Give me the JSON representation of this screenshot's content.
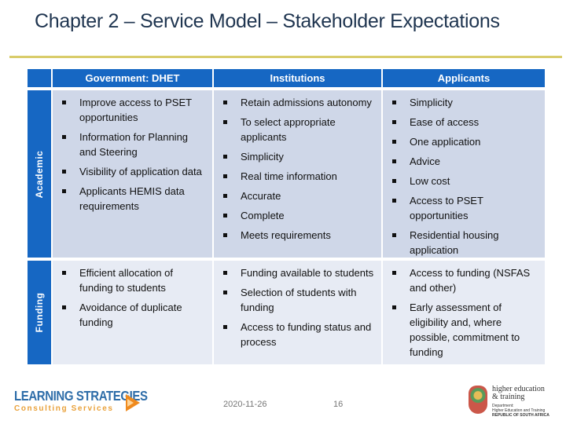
{
  "slide": {
    "title": "Chapter 2 – Service Model – Stakeholder Expectations",
    "accent_color": "#1667c3",
    "rule_color": "#d9cc6a"
  },
  "table": {
    "headers": [
      "",
      "Government: DHET",
      "Institutions",
      "Applicants"
    ],
    "rows": [
      {
        "label": "Academic",
        "government": [
          "Improve access to PSET opportunities",
          "Information for Planning and Steering",
          "Visibility of application data",
          "Applicants HEMIS data requirements"
        ],
        "institutions": [
          "Retain admissions autonomy",
          "To select appropriate applicants",
          "Simplicity",
          "Real time information",
          "Accurate",
          "Complete",
          "Meets requirements"
        ],
        "applicants": [
          "Simplicity",
          "Ease of access",
          "One application",
          "Advice",
          "Low cost",
          "Access to PSET opportunities",
          "Residential housing application"
        ]
      },
      {
        "label": "Funding",
        "government": [
          "Efficient allocation of funding to students",
          "Avoidance of duplicate funding"
        ],
        "institutions": [
          "Funding available to students",
          "Selection of students with funding",
          "Access to funding status and process"
        ],
        "applicants": [
          "Access to funding (NSFAS and other)",
          "Early assessment of eligibility and, where possible, commitment to funding"
        ]
      }
    ]
  },
  "footer": {
    "logo_left_main": "LEARNING STRATEGIES",
    "logo_left_sub": "Consulting Services",
    "date": "2020-11-26",
    "page_number": "16",
    "logo_right_line1": "higher education",
    "logo_right_line2": "& training",
    "logo_right_dept1": "Department:",
    "logo_right_dept2": "Higher Education and Training",
    "logo_right_dept3": "REPUBLIC OF SOUTH AFRICA"
  }
}
